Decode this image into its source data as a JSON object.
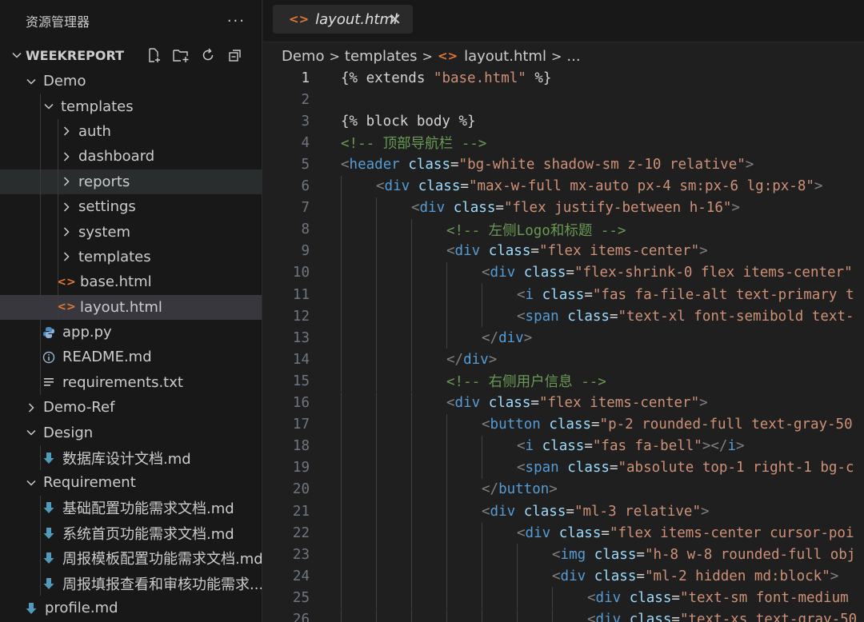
{
  "sidebar": {
    "title": "资源管理器",
    "more_label": "···",
    "section": "WEEKREPORT",
    "actions": [
      "new-file-icon",
      "new-folder-icon",
      "refresh-icon",
      "collapse-all-icon"
    ],
    "items": [
      {
        "label": "Demo",
        "depth": 1,
        "kind": "folder",
        "open": true,
        "icon": "chevron-down-icon"
      },
      {
        "label": "templates",
        "depth": 2,
        "kind": "folder",
        "open": true,
        "icon": "chevron-down-icon"
      },
      {
        "label": "auth",
        "depth": 3,
        "kind": "folder",
        "open": false,
        "icon": "chevron-right-icon"
      },
      {
        "label": "dashboard",
        "depth": 3,
        "kind": "folder",
        "open": false,
        "icon": "chevron-right-icon"
      },
      {
        "label": "reports",
        "depth": 3,
        "kind": "folder",
        "open": false,
        "icon": "chevron-right-icon"
      },
      {
        "label": "settings",
        "depth": 3,
        "kind": "folder",
        "open": false,
        "icon": "chevron-right-icon"
      },
      {
        "label": "system",
        "depth": 3,
        "kind": "folder",
        "open": false,
        "icon": "chevron-right-icon"
      },
      {
        "label": "templates",
        "depth": 3,
        "kind": "folder",
        "open": false,
        "icon": "chevron-right-icon"
      },
      {
        "label": "base.html",
        "depth": 3,
        "kind": "html",
        "icon": "html-file-icon"
      },
      {
        "label": "layout.html",
        "depth": 3,
        "kind": "html",
        "icon": "html-file-icon",
        "selected": true
      },
      {
        "label": "app.py",
        "depth": 2,
        "kind": "python",
        "icon": "python-file-icon"
      },
      {
        "label": "README.md",
        "depth": 2,
        "kind": "info",
        "icon": "info-file-icon"
      },
      {
        "label": "requirements.txt",
        "depth": 2,
        "kind": "text",
        "icon": "text-file-icon"
      },
      {
        "label": "Demo-Ref",
        "depth": 1,
        "kind": "folder",
        "open": false,
        "icon": "chevron-right-icon"
      },
      {
        "label": "Design",
        "depth": 1,
        "kind": "folder",
        "open": true,
        "icon": "chevron-down-icon"
      },
      {
        "label": "数据库设计文档.md",
        "depth": 2,
        "kind": "markdown",
        "icon": "markdown-file-icon"
      },
      {
        "label": "Requirement",
        "depth": 1,
        "kind": "folder",
        "open": true,
        "icon": "chevron-down-icon"
      },
      {
        "label": "基础配置功能需求文档.md",
        "depth": 2,
        "kind": "markdown",
        "icon": "markdown-file-icon"
      },
      {
        "label": "系统首页功能需求文档.md",
        "depth": 2,
        "kind": "markdown",
        "icon": "markdown-file-icon"
      },
      {
        "label": "周报模板配置功能需求文档.md",
        "depth": 2,
        "kind": "markdown",
        "icon": "markdown-file-icon"
      },
      {
        "label": "周报填报查看和审核功能需求...",
        "depth": 2,
        "kind": "markdown",
        "icon": "markdown-file-icon"
      },
      {
        "label": "profile.md",
        "depth": 1,
        "kind": "markdown",
        "icon": "markdown-file-icon"
      }
    ]
  },
  "tab": {
    "label": "layout.html",
    "close": "✕"
  },
  "breadcrumb": [
    "Demo",
    "templates",
    "layout.html",
    "..."
  ],
  "colors": {
    "background": "#1f1f1f",
    "sidebar": "#181818",
    "selected": "#37373d",
    "html_icon": "#e37933",
    "python_icon": "#4b8bbe",
    "markdown_icon": "#519aba",
    "string": "#ce9178",
    "tag": "#569cd6",
    "attribute": "#9cdcfe",
    "comment": "#6a9955"
  },
  "editor": {
    "active_line": 1,
    "lines": [
      {
        "n": "1",
        "indent": 0,
        "tokens": [
          [
            "t",
            "{% extends "
          ],
          [
            "s",
            "\"base.html\""
          ],
          [
            "t",
            " %}"
          ]
        ]
      },
      {
        "n": "2",
        "indent": 0,
        "tokens": []
      },
      {
        "n": "3",
        "indent": 0,
        "tokens": [
          [
            "t",
            "{% block body %}"
          ]
        ]
      },
      {
        "n": "4",
        "indent": 0,
        "tokens": [
          [
            "c",
            "<!-- 顶部导航栏 -->"
          ]
        ]
      },
      {
        "n": "5",
        "indent": 0,
        "tokens": [
          [
            "p",
            "<"
          ],
          [
            "g",
            "header"
          ],
          [
            "t",
            " "
          ],
          [
            "a",
            "class"
          ],
          [
            "t",
            "="
          ],
          [
            "s",
            "\"bg-white shadow-sm z-10 relative\""
          ],
          [
            "p",
            ">"
          ]
        ]
      },
      {
        "n": "6",
        "indent": 1,
        "tokens": [
          [
            "p",
            "<"
          ],
          [
            "g",
            "div"
          ],
          [
            "t",
            " "
          ],
          [
            "a",
            "class"
          ],
          [
            "t",
            "="
          ],
          [
            "s",
            "\"max-w-full mx-auto px-4 sm:px-6 lg:px-8\""
          ],
          [
            "p",
            ">"
          ]
        ]
      },
      {
        "n": "7",
        "indent": 2,
        "tokens": [
          [
            "p",
            "<"
          ],
          [
            "g",
            "div"
          ],
          [
            "t",
            " "
          ],
          [
            "a",
            "class"
          ],
          [
            "t",
            "="
          ],
          [
            "s",
            "\"flex justify-between h-16\""
          ],
          [
            "p",
            ">"
          ]
        ]
      },
      {
        "n": "8",
        "indent": 3,
        "tokens": [
          [
            "c",
            "<!-- 左侧Logo和标题 -->"
          ]
        ]
      },
      {
        "n": "9",
        "indent": 3,
        "tokens": [
          [
            "p",
            "<"
          ],
          [
            "g",
            "div"
          ],
          [
            "t",
            " "
          ],
          [
            "a",
            "class"
          ],
          [
            "t",
            "="
          ],
          [
            "s",
            "\"flex items-center\""
          ],
          [
            "p",
            ">"
          ]
        ]
      },
      {
        "n": "10",
        "indent": 4,
        "tokens": [
          [
            "p",
            "<"
          ],
          [
            "g",
            "div"
          ],
          [
            "t",
            " "
          ],
          [
            "a",
            "class"
          ],
          [
            "t",
            "="
          ],
          [
            "s",
            "\"flex-shrink-0 flex items-center\""
          ]
        ]
      },
      {
        "n": "11",
        "indent": 5,
        "tokens": [
          [
            "p",
            "<"
          ],
          [
            "g",
            "i"
          ],
          [
            "t",
            " "
          ],
          [
            "a",
            "class"
          ],
          [
            "t",
            "="
          ],
          [
            "s",
            "\"fas fa-file-alt text-primary t"
          ]
        ]
      },
      {
        "n": "12",
        "indent": 5,
        "tokens": [
          [
            "p",
            "<"
          ],
          [
            "g",
            "span"
          ],
          [
            "t",
            " "
          ],
          [
            "a",
            "class"
          ],
          [
            "t",
            "="
          ],
          [
            "s",
            "\"text-xl font-semibold text-"
          ]
        ]
      },
      {
        "n": "13",
        "indent": 4,
        "tokens": [
          [
            "p",
            "</"
          ],
          [
            "g",
            "div"
          ],
          [
            "p",
            ">"
          ]
        ]
      },
      {
        "n": "14",
        "indent": 3,
        "tokens": [
          [
            "p",
            "</"
          ],
          [
            "g",
            "div"
          ],
          [
            "p",
            ">"
          ]
        ]
      },
      {
        "n": "15",
        "indent": 3,
        "tokens": [
          [
            "c",
            "<!-- 右侧用户信息 -->"
          ]
        ]
      },
      {
        "n": "16",
        "indent": 3,
        "tokens": [
          [
            "p",
            "<"
          ],
          [
            "g",
            "div"
          ],
          [
            "t",
            " "
          ],
          [
            "a",
            "class"
          ],
          [
            "t",
            "="
          ],
          [
            "s",
            "\"flex items-center\""
          ],
          [
            "p",
            ">"
          ]
        ]
      },
      {
        "n": "17",
        "indent": 4,
        "tokens": [
          [
            "p",
            "<"
          ],
          [
            "g",
            "button"
          ],
          [
            "t",
            " "
          ],
          [
            "a",
            "class"
          ],
          [
            "t",
            "="
          ],
          [
            "s",
            "\"p-2 rounded-full text-gray-50"
          ]
        ]
      },
      {
        "n": "18",
        "indent": 5,
        "tokens": [
          [
            "p",
            "<"
          ],
          [
            "g",
            "i"
          ],
          [
            "t",
            " "
          ],
          [
            "a",
            "class"
          ],
          [
            "t",
            "="
          ],
          [
            "s",
            "\"fas fa-bell\""
          ],
          [
            "p",
            "></"
          ],
          [
            "g",
            "i"
          ],
          [
            "p",
            ">"
          ]
        ]
      },
      {
        "n": "19",
        "indent": 5,
        "tokens": [
          [
            "p",
            "<"
          ],
          [
            "g",
            "span"
          ],
          [
            "t",
            " "
          ],
          [
            "a",
            "class"
          ],
          [
            "t",
            "="
          ],
          [
            "s",
            "\"absolute top-1 right-1 bg-c"
          ]
        ]
      },
      {
        "n": "20",
        "indent": 4,
        "tokens": [
          [
            "p",
            "</"
          ],
          [
            "g",
            "button"
          ],
          [
            "p",
            ">"
          ]
        ]
      },
      {
        "n": "21",
        "indent": 4,
        "tokens": [
          [
            "p",
            "<"
          ],
          [
            "g",
            "div"
          ],
          [
            "t",
            " "
          ],
          [
            "a",
            "class"
          ],
          [
            "t",
            "="
          ],
          [
            "s",
            "\"ml-3 relative\""
          ],
          [
            "p",
            ">"
          ]
        ]
      },
      {
        "n": "22",
        "indent": 5,
        "tokens": [
          [
            "p",
            "<"
          ],
          [
            "g",
            "div"
          ],
          [
            "t",
            " "
          ],
          [
            "a",
            "class"
          ],
          [
            "t",
            "="
          ],
          [
            "s",
            "\"flex items-center cursor-poi"
          ]
        ]
      },
      {
        "n": "23",
        "indent": 6,
        "tokens": [
          [
            "p",
            "<"
          ],
          [
            "g",
            "img"
          ],
          [
            "t",
            " "
          ],
          [
            "a",
            "class"
          ],
          [
            "t",
            "="
          ],
          [
            "s",
            "\"h-8 w-8 rounded-full obj"
          ]
        ]
      },
      {
        "n": "24",
        "indent": 6,
        "tokens": [
          [
            "p",
            "<"
          ],
          [
            "g",
            "div"
          ],
          [
            "t",
            " "
          ],
          [
            "a",
            "class"
          ],
          [
            "t",
            "="
          ],
          [
            "s",
            "\"ml-2 hidden md:block\""
          ],
          [
            "p",
            ">"
          ]
        ]
      },
      {
        "n": "25",
        "indent": 7,
        "tokens": [
          [
            "p",
            "<"
          ],
          [
            "g",
            "div"
          ],
          [
            "t",
            " "
          ],
          [
            "a",
            "class"
          ],
          [
            "t",
            "="
          ],
          [
            "s",
            "\"text-sm font-medium "
          ]
        ]
      },
      {
        "n": "26",
        "indent": 7,
        "tokens": [
          [
            "p",
            "<"
          ],
          [
            "g",
            "div"
          ],
          [
            "t",
            " "
          ],
          [
            "a",
            "class"
          ],
          [
            "t",
            "="
          ],
          [
            "s",
            "\"text-xs text-gray-50"
          ]
        ]
      }
    ]
  }
}
